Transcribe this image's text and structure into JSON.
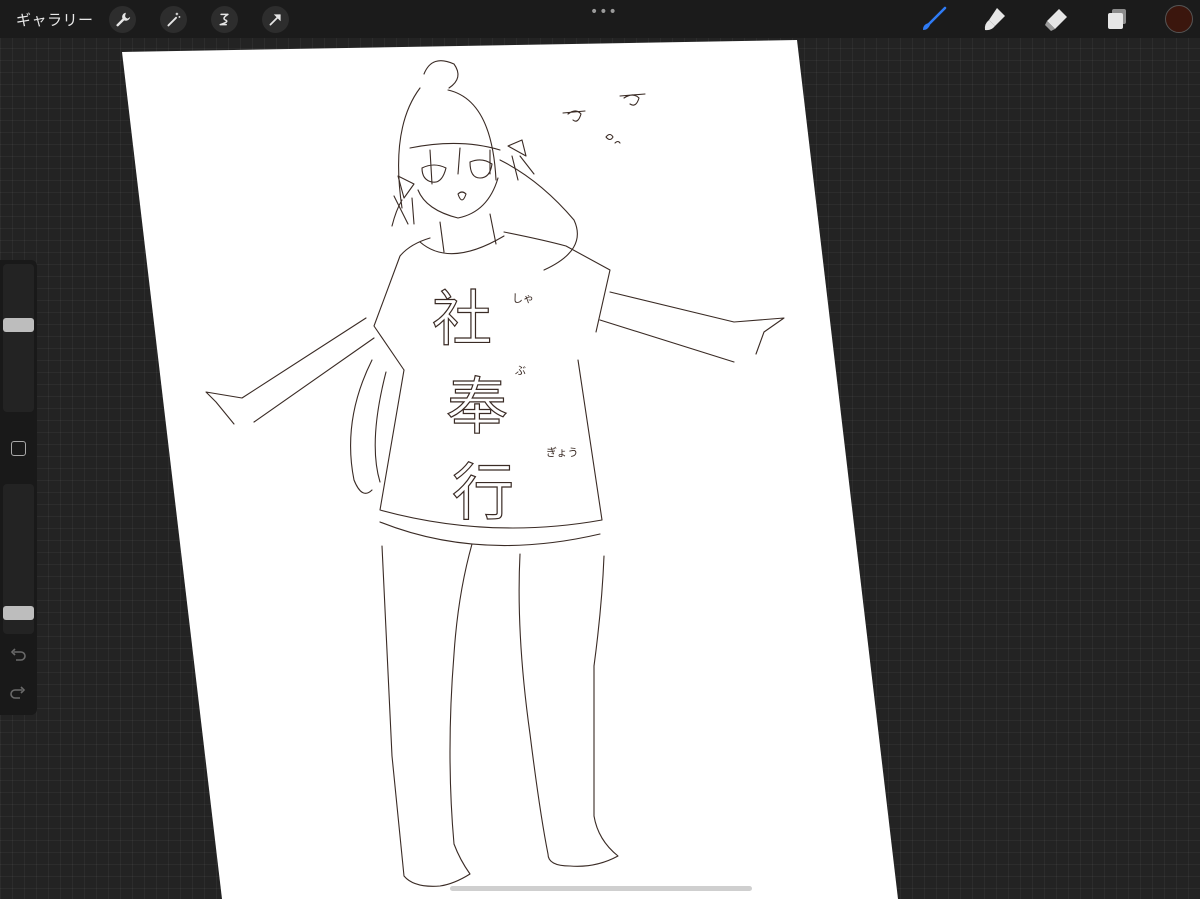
{
  "toolbar": {
    "gallery_label": "ギャラリー",
    "left_tools": [
      "wrench-icon",
      "magic-wand-icon",
      "selection-icon",
      "transform-arrow-icon"
    ],
    "more_menu": "•••",
    "right_tools": [
      "brush-icon",
      "smudge-icon",
      "eraser-icon",
      "layers-icon"
    ],
    "active_tool": "brush",
    "accent_color": "#2f7bf5",
    "current_color": "#3b160d"
  },
  "sidebar": {
    "brush_size_level": 0.6,
    "opacity_level": 0.1,
    "modifier_icon": "square-modifier-icon",
    "undo_icon": "undo-icon",
    "redo_icon": "redo-icon"
  },
  "canvas": {
    "background": "#ffffff",
    "line_color": "#3a2b25",
    "shirt_text": [
      "社",
      "奉",
      "行"
    ],
    "furigana": [
      "しゃ",
      "ぶ",
      "ぎょう"
    ]
  }
}
